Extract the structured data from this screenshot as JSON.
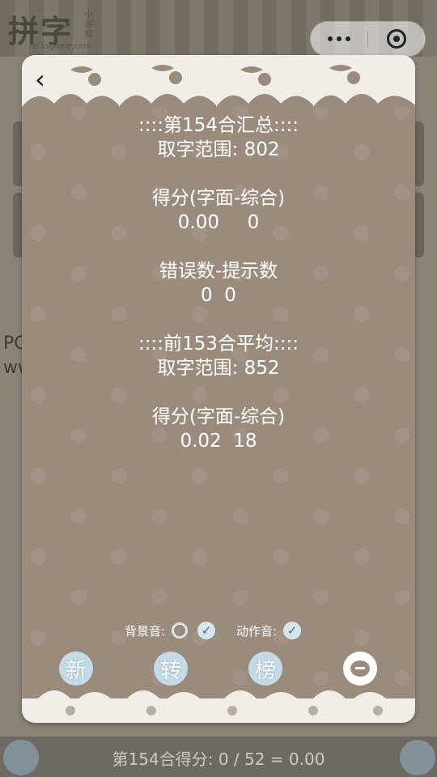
{
  "background": {
    "logo": "拼字",
    "logo_sub": "小游戏",
    "logo_url": "zi.logame.com",
    "text_fragment_1": "PC",
    "text_fragment_2": "ww",
    "bottom_score": "第154合得分: 0 / 52 = 0.00"
  },
  "capsule": {
    "more_icon": "more-dots-icon",
    "close_icon": "target-close-icon"
  },
  "modal": {
    "back_icon": "back-chevron-icon",
    "back_glyph": "‹",
    "current": {
      "header": "::::第154合汇总::::",
      "range": "取字范围: 802",
      "score_label": "得分(字面-综合)",
      "score_value": "0.00  0",
      "errors_label": "错误数-提示数",
      "errors_value": "0  0"
    },
    "previous": {
      "header": "::::前153合平均::::",
      "range": "取字范围: 852",
      "score_label": "得分(字面-综合)",
      "score_value": "0.02  18"
    },
    "sound": {
      "bg_label": "背景音:",
      "bg_radio_checked": false,
      "bg_check_checked": true,
      "action_label": "动作音:",
      "action_check_checked": true,
      "check_glyph": "✓"
    },
    "actions": [
      {
        "label": "新",
        "icon": "new-char-icon"
      },
      {
        "label": "转",
        "icon": "switch-char-icon"
      },
      {
        "label": "榜",
        "icon": "leaderboard-char-icon"
      },
      {
        "label": "",
        "icon": "chat-bubble-icon"
      }
    ]
  },
  "colors": {
    "modal_bg": "#9a8c7d",
    "accent": "#c4dbe7",
    "text": "#ffffff"
  }
}
